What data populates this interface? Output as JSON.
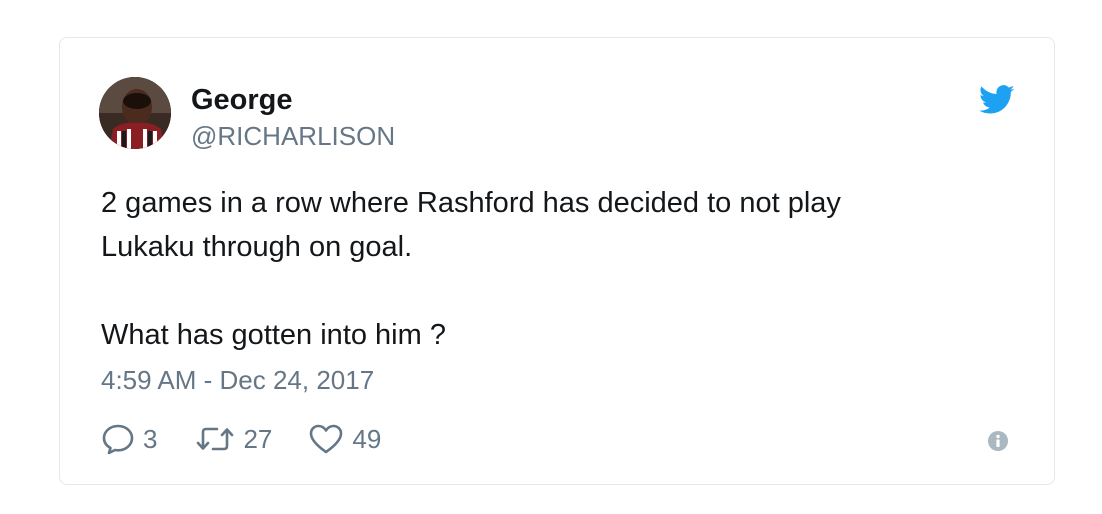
{
  "tweet": {
    "author": {
      "name": "George",
      "handle": "@RICHARLISON"
    },
    "text_lines": [
      "2 games in a row where Rashford has decided to not play",
      "Lukaku through on goal.",
      "",
      "What has gotten into him ?"
    ],
    "timestamp": "4:59 AM - Dec 24, 2017",
    "stats": {
      "replies": "3",
      "retweets": "27",
      "likes": "49"
    }
  },
  "colors": {
    "text": "#14171a",
    "muted": "#657786",
    "twitter_blue": "#1da1f2",
    "border": "#e1e8ed",
    "info_icon": "#aab8c2"
  },
  "icons": {
    "brand": "twitter-bird-icon",
    "reply": "reply-bubble-icon",
    "retweet": "retweet-icon",
    "like": "heart-icon",
    "info": "info-icon"
  }
}
